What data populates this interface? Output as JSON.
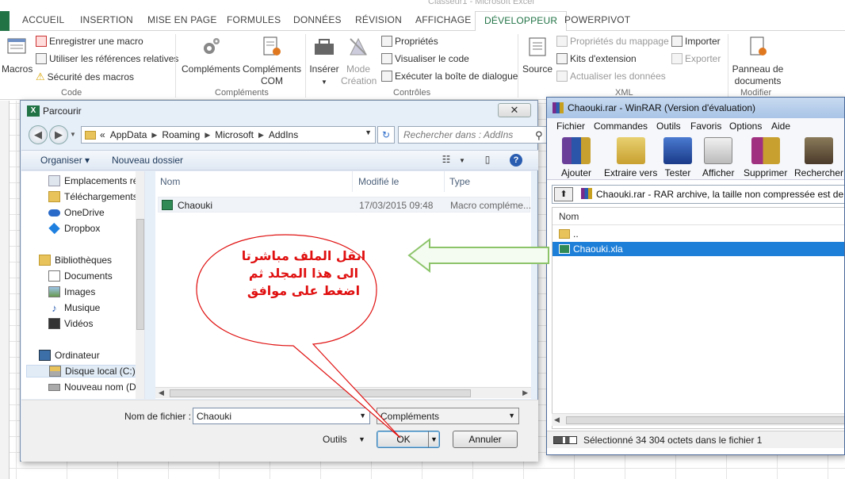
{
  "excel": {
    "window_title": "Classeur1 - Microsoft Excel",
    "tabs": [
      {
        "label": "ACCUEIL"
      },
      {
        "label": "INSERTION"
      },
      {
        "label": "MISE EN PAGE"
      },
      {
        "label": "FORMULES"
      },
      {
        "label": "DONNÉES"
      },
      {
        "label": "RÉVISION"
      },
      {
        "label": "AFFICHAGE"
      },
      {
        "label": "DÉVELOPPEUR",
        "active": true
      },
      {
        "label": "POWERPIVOT"
      }
    ],
    "ribbon": {
      "code": {
        "macros_label": "Macros",
        "record_macro": "Enregistrer une macro",
        "relative_refs": "Utiliser les références relatives",
        "macro_security": "Sécurité des macros",
        "group_label": "Code"
      },
      "addins": {
        "complements": "Compléments",
        "complements_com_1": "Compléments",
        "complements_com_2": "COM",
        "group_label": "Compléments"
      },
      "controls": {
        "insert": "Insérer",
        "mode_1": "Mode",
        "mode_2": "Création",
        "properties": "Propriétés",
        "view_code": "Visualiser le code",
        "run_dialog": "Exécuter la boîte de dialogue",
        "group_label": "Contrôles"
      },
      "xml": {
        "source": "Source",
        "map_props": "Propriétés du mappage",
        "ext_packs": "Kits d'extension",
        "refresh_data": "Actualiser les données",
        "import": "Importer",
        "export": "Exporter",
        "group_label": "XML"
      },
      "modify": {
        "doc_panel_1": "Panneau de",
        "doc_panel_2": "documents",
        "group_label": "Modifier"
      }
    }
  },
  "browse_dialog": {
    "title": "Parcourir",
    "close_glyph": "✕",
    "breadcrumb": [
      "AppData",
      "Roaming",
      "Microsoft",
      "AddIns"
    ],
    "breadcrumb_prefix": "«",
    "search_placeholder": "Rechercher dans : AddIns",
    "toolbar": {
      "organize": "Organiser ▾",
      "new_folder": "Nouveau dossier"
    },
    "nav": [
      {
        "label": "Emplacements ré",
        "icon": "recent-places-icon"
      },
      {
        "label": "Téléchargements",
        "icon": "downloads-icon"
      },
      {
        "label": "OneDrive",
        "icon": "onedrive-icon"
      },
      {
        "label": "Dropbox",
        "icon": "dropbox-icon"
      },
      {
        "label": "Bibliothèques",
        "icon": "libraries-icon"
      },
      {
        "label": "Documents",
        "icon": "documents-icon"
      },
      {
        "label": "Images",
        "icon": "images-icon"
      },
      {
        "label": "Musique",
        "icon": "music-icon"
      },
      {
        "label": "Vidéos",
        "icon": "videos-icon"
      },
      {
        "label": "Ordinateur",
        "icon": "computer-icon"
      },
      {
        "label": "Disque local (C:)",
        "icon": "drive-icon",
        "selected": true
      },
      {
        "label": "Nouveau nom (D",
        "icon": "drive-icon"
      }
    ],
    "columns": {
      "name": "Nom",
      "modified": "Modifié le",
      "type": "Type"
    },
    "files": [
      {
        "name": "Chaouki",
        "modified": "17/03/2015 09:48",
        "type": "Macro compléme..."
      }
    ],
    "filename_label": "Nom de fichier :",
    "filename_value": "Chaouki",
    "filetype_value": "Compléments",
    "tools_label": "Outils",
    "ok_label": "OK",
    "cancel_label": "Annuler"
  },
  "winrar": {
    "title": "Chaouki.rar - WinRAR (Version d'évaluation)",
    "menu": [
      "Fichier",
      "Commandes",
      "Outils",
      "Favoris",
      "Options",
      "Aide"
    ],
    "tools": [
      {
        "label": "Ajouter",
        "color": "#6a3f9a"
      },
      {
        "label": "Extraire vers",
        "color": "#c8a030"
      },
      {
        "label": "Tester",
        "color": "#2a55a8"
      },
      {
        "label": "Afficher",
        "color": "#8a8a8a"
      },
      {
        "label": "Supprimer",
        "color": "#a03080"
      },
      {
        "label": "Rechercher",
        "color": "#6a5a3a"
      }
    ],
    "path_text": "Chaouki.rar - RAR archive, la taille non compressée est de",
    "list_header": "Nom",
    "rows": [
      {
        "name": "..",
        "kind": "folder"
      },
      {
        "name": "Chaouki.xla",
        "kind": "xla",
        "selected": true
      }
    ],
    "status": "Sélectionné 34 304 octets dans le fichier 1"
  },
  "annotation": {
    "lines": [
      "انقل الملف مباشرتا",
      "الى هذا المجلد ثم",
      "اضغط على موافق"
    ],
    "color": "#e01010"
  }
}
